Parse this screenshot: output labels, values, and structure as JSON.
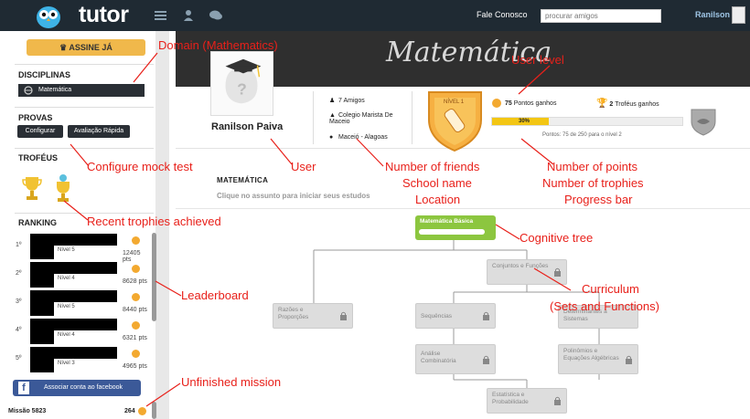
{
  "topbar": {
    "logo": "tutor",
    "fale_conosco": "Fale Conosco",
    "search_placeholder": "procurar amigos",
    "user_name": "Ranilson"
  },
  "sidebar": {
    "assine_label": "ASSINE JÁ",
    "disciplinas_title": "DISCIPLINAS",
    "disciplina_item": "Matemática",
    "provas_title": "PROVAS",
    "configurar_label": "Configurar",
    "avaliacao_label": "Avaliação Rápida",
    "trofeus_title": "TROFÉUS",
    "ranking_title": "RANKING",
    "ranking": [
      {
        "pos": "1º",
        "level": "Nível 5",
        "points": "12405 pts"
      },
      {
        "pos": "2º",
        "level": "Nível 4",
        "points": "8628 pts"
      },
      {
        "pos": "3º",
        "level": "Nível 5",
        "points": "8440 pts"
      },
      {
        "pos": "4º",
        "level": "Nível 4",
        "points": "6321 pts"
      },
      {
        "pos": "5º",
        "level": "Nível 3",
        "points": "4965 pts"
      }
    ],
    "facebook_label": "Associar conta ao facebook",
    "mission_label": "Missão 5823",
    "mission_points": "264"
  },
  "profile": {
    "banner_title": "Matemática",
    "name": "Ranilson Paiva",
    "friends": "7 Amigos",
    "school": "Colegio Marista De Maceio",
    "location": "Maceió - Alagoas",
    "level_badge": "NÍVEL 1",
    "points_value": "75",
    "points_text": "Pontos ganhos",
    "trophies_value": "2",
    "trophies_text": "Troféus ganhos",
    "progress_label": "30%",
    "progress_fraction": 0.3,
    "progress_sub_pre": "Pontos: ",
    "progress_sub_val": "75",
    "progress_sub_post": " de 250 para o nível 2"
  },
  "content": {
    "section_title": "MATEMÁTICA",
    "section_subtitle": "Clique no assunto para iniciar seus estudos",
    "tree": {
      "root": "Matemática Básica",
      "nodes": [
        "Conjuntos e Funções",
        "Razões e Proporções",
        "Sequências",
        "Determinantes a Sistemas",
        "Análise Combinatória",
        "Polinômios e Equações Algébricas",
        "Estatística e Probabilidade"
      ]
    }
  },
  "annotations": {
    "domain": "Domain (Mathematics)",
    "user_level": "User level",
    "configure": "Configure mock test",
    "user": "User",
    "friends": "Number of friends",
    "school": "School name",
    "location": "Location",
    "points": "Number of points",
    "trophies": "Number of trophies",
    "progress": "Progress bar",
    "recent_trophies": "Recent trophies achieved",
    "cognitive_tree": "Cognitive tree",
    "leaderboard": "Leaderboard",
    "curriculum": "Curriculum",
    "curriculum_sub": "(Sets and Functions)",
    "unfinished": "Unfinished mission"
  },
  "colors": {
    "topbar": "#1f2a33",
    "accent_orange": "#f0b84b",
    "tree_root": "#8cc63f",
    "annotation_red": "#e8201a",
    "facebook": "#3b5998"
  }
}
